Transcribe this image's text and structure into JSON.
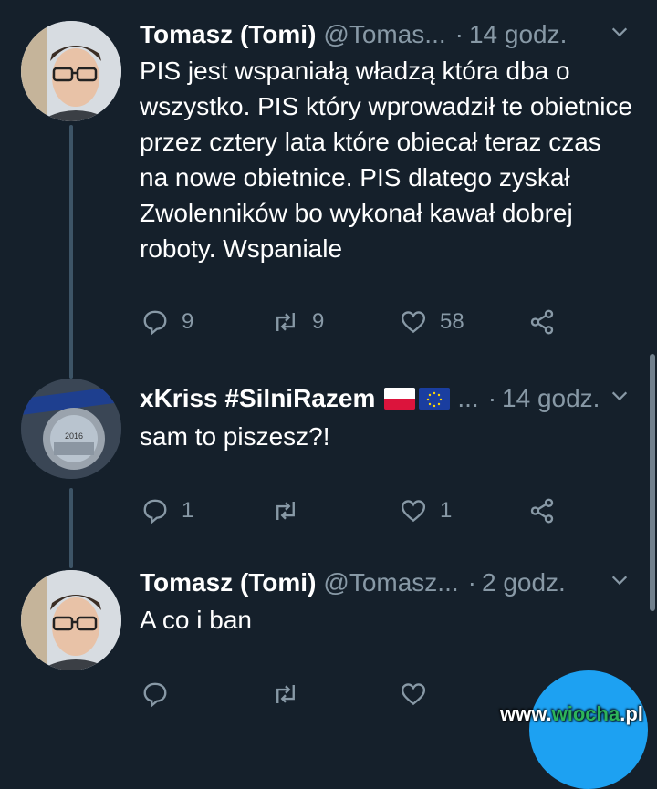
{
  "tweets": [
    {
      "name": "Tomasz (Tomi)",
      "handle": "@Tomas...",
      "dot": "·",
      "time": "14 godz.",
      "text": "PIS jest wspaniałą władzą która dba o wszystko. PIS który wprowadził te obietnice przez cztery lata które obiecał teraz czas na nowe obietnice. PIS dlatego zyskał Zwolenników bo wykonał kawał dobrej roboty. Wspaniale",
      "replies": "9",
      "retweets": "9",
      "likes": "58",
      "avatar_icon": "person-avatar"
    },
    {
      "name": "xKriss #SilniRazem",
      "handle": "...",
      "dot": "·",
      "time": "14 godz.",
      "text": "sam to piszesz?!",
      "replies": "1",
      "retweets": "",
      "likes": "1",
      "avatar_icon": "medal-avatar",
      "medal_year": "2016",
      "flags": [
        "poland-flag",
        "eu-flag"
      ]
    },
    {
      "name": "Tomasz (Tomi)",
      "handle": "@Tomasz...",
      "dot": "·",
      "time": "2 godz.",
      "text": "A co i ban",
      "replies": "",
      "retweets": "",
      "likes": "",
      "avatar_icon": "person-avatar"
    }
  ],
  "watermark": {
    "prefix": "www.",
    "highlight": "wiocha",
    "suffix": ".pl"
  },
  "colors": {
    "background": "#15202b",
    "secondary_text": "#8899a6",
    "accent": "#1da1f2"
  }
}
